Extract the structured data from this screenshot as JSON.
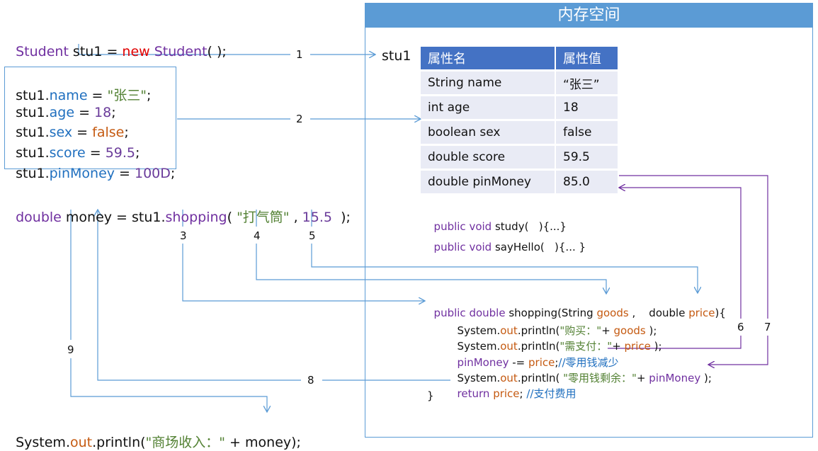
{
  "memory": {
    "title": "内存空间",
    "object_label": "stu1",
    "table": {
      "headers": [
        "属性名",
        "属性值"
      ],
      "rows": [
        {
          "name": "String name",
          "value": "“张三”"
        },
        {
          "name": "int age",
          "value": "18"
        },
        {
          "name": "boolean sex",
          "value": "false"
        },
        {
          "name": "double score",
          "value": "59.5"
        },
        {
          "name": "double pinMoney",
          "value": "85.0"
        }
      ]
    },
    "methods": {
      "study_kw": "public void",
      "study_rest": " study(   ){...}",
      "sayhello_kw": "public void",
      "sayhello_rest": " sayHello(   ){... }"
    },
    "shopping": {
      "sig_kw": "public double",
      "sig_name": " shopping(String ",
      "sig_goods": "goods",
      "sig_mid": " ,    double ",
      "sig_price": "price",
      "sig_end": "){",
      "l1_a": "System.",
      "l1_out": "out",
      "l1_b": ".println(",
      "l1_str": "\"购买：\"",
      "l1_c": "+ ",
      "l1_var": "goods",
      "l1_d": " );",
      "l2_a": "System.",
      "l2_out": "out",
      "l2_b": ".println(",
      "l2_str": "\"需支付：\"",
      "l2_c": "+ ",
      "l2_var": "price",
      "l2_d": " );",
      "l3_var": "pinMoney",
      "l3_op": " -= ",
      "l3_price": "price",
      "l3_semi": ";",
      "l3_comment": "//零用钱减少",
      "l4_a": "System.",
      "l4_out": "out",
      "l4_b": ".println( ",
      "l4_str": "\"零用钱剩余：\"",
      "l4_c": "+ ",
      "l4_var": "pinMoney",
      "l4_d": " );",
      "l5_kw": "return",
      "l5_price": " price",
      "l5_semi": "; ",
      "l5_comment": "//支付费用",
      "close": "}"
    }
  },
  "code": {
    "line1": {
      "type1": "Student",
      "var": " stu1 = ",
      "kw": "new",
      "type2": " Student",
      "end": "( );"
    },
    "assign": [
      {
        "obj": "stu1.",
        "field": "name",
        "op": " = ",
        "val": "\"张三\"",
        "end": ";"
      },
      {
        "obj": "stu1.",
        "field": "age",
        "op": " = ",
        "val": "18",
        "end": ";"
      },
      {
        "obj": "stu1.",
        "field": "sex",
        "op": " = ",
        "val": "false",
        "end": ";"
      },
      {
        "obj": "stu1.",
        "field": "score",
        "op": " = ",
        "val": "59.5",
        "end": ";"
      },
      {
        "obj": "stu1.",
        "field": "pinMoney",
        "op": " = ",
        "val": "100D",
        "end": ";"
      }
    ],
    "line3": {
      "type": "double",
      "var": " money = stu1.",
      "method": "shopping",
      "open": "( ",
      "arg1": "\"打气筒\"",
      "sep": " , ",
      "arg2": "15.5",
      "end": "  );"
    },
    "line4": {
      "a": "System.",
      "out": "out",
      "b": ".println(",
      "str": "\"商场收入：\"",
      "c": " + money);"
    }
  },
  "arrow_labels": [
    "1",
    "2",
    "3",
    "4",
    "5",
    "6",
    "7",
    "8",
    "9"
  ]
}
